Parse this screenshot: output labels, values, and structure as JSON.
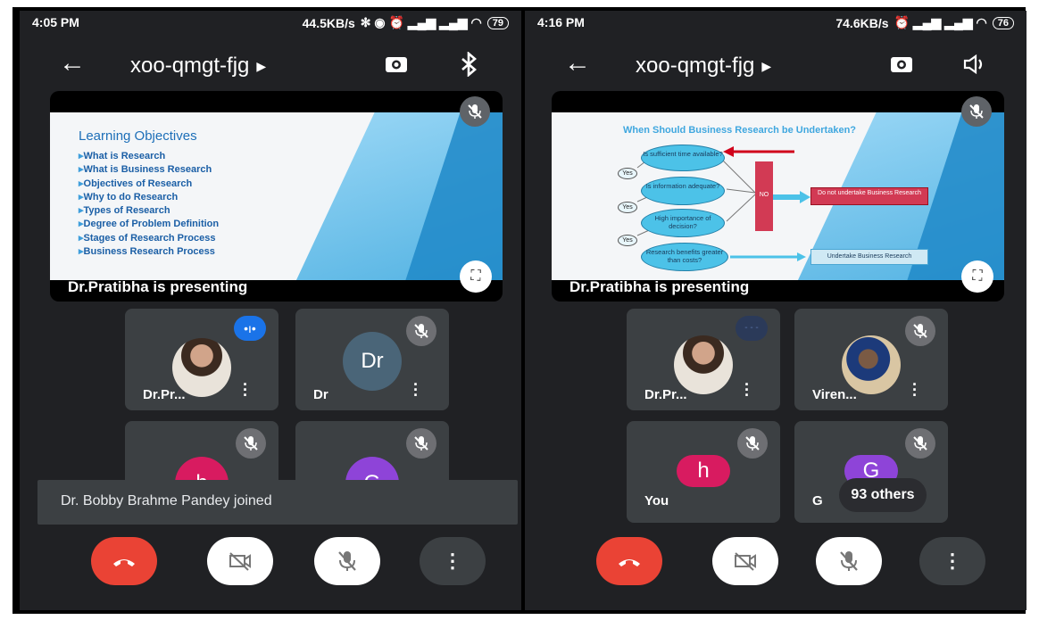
{
  "left": {
    "status": {
      "time": "4:05 PM",
      "speed": "44.5KB/s",
      "battery": "79"
    },
    "meeting_code": "xoo-qmgt-fjg",
    "share": {
      "presenting_label": "Dr.Pratibha is presenting",
      "slide_title": "Learning Objectives",
      "slide_items": [
        "What is Research",
        "What is Business Research",
        "Objectives of Research",
        "Why to do Research",
        "Types of Research",
        "Degree of Problem Definition",
        "Stages of Research Process",
        "Business Research Process"
      ]
    },
    "tiles": [
      {
        "name": "Dr.Pr..."
      },
      {
        "name": "Dr",
        "initial": "Dr"
      },
      {
        "initial": "h"
      },
      {
        "initial": "G"
      }
    ],
    "toast": "Dr. Bobby Brahme Pandey joined"
  },
  "right": {
    "status": {
      "time": "4:16 PM",
      "speed": "74.6KB/s",
      "battery": "76"
    },
    "meeting_code": "xoo-qmgt-fjg",
    "share": {
      "presenting_label": "Dr.Pratibha is presenting",
      "slide_title": "When Should Business Research be Undertaken?",
      "q1": "Is sufficient time available?",
      "q2": "Is information adequate?",
      "q3": "High importance of decision?",
      "q4": "Research benefits greater than costs?",
      "yes": "Yes",
      "no": "NO",
      "do_not": "Do not undertake Business Research",
      "undertake": "Undertake Business Research"
    },
    "tiles": [
      {
        "name": "Dr.Pr..."
      },
      {
        "name": "Viren..."
      },
      {
        "name": "You",
        "initial": "h"
      },
      {
        "name": "G",
        "initial": "G"
      }
    ],
    "others": "93 others"
  },
  "icons": [
    "back-arrow-icon",
    "switch-camera-icon",
    "bluetooth-icon",
    "speaker-icon",
    "mic-off-icon",
    "video-off-icon",
    "end-call-icon",
    "more-vert-icon",
    "fullscreen-icon",
    "speaking-indicator-icon"
  ],
  "colors": {
    "background": "#202124",
    "tile": "#3c4043",
    "end_call": "#ea4335",
    "avatar_h": "#d81b60",
    "avatar_g": "#8e44d8",
    "avatar_dr": "#4a6578",
    "accent": "#1a73e8"
  }
}
